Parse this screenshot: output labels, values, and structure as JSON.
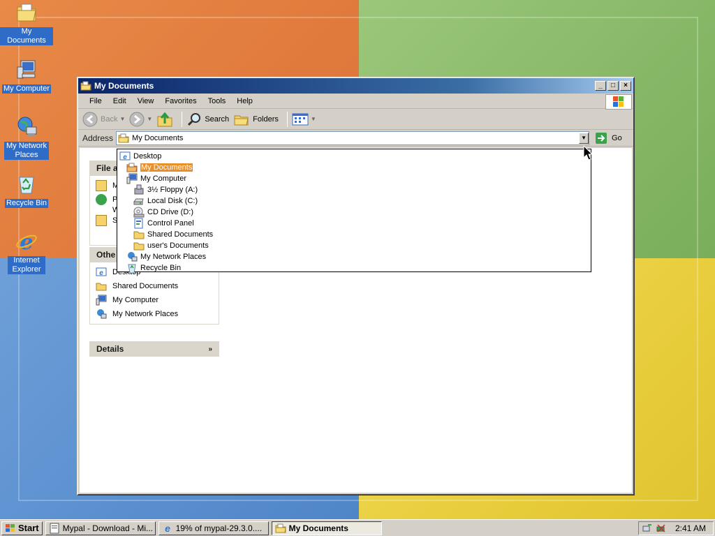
{
  "desktop": {
    "icons": [
      {
        "label": "My Documents",
        "icon": "my-documents-icon"
      },
      {
        "label": "My Computer",
        "icon": "my-computer-icon"
      },
      {
        "label": "My Network Places",
        "icon": "network-places-icon"
      },
      {
        "label": "Recycle Bin",
        "icon": "recycle-bin-icon"
      },
      {
        "label": "Internet Explorer",
        "icon": "internet-explorer-icon"
      }
    ]
  },
  "window": {
    "title": "My Documents",
    "menu": [
      "File",
      "Edit",
      "View",
      "Favorites",
      "Tools",
      "Help"
    ],
    "toolbar": {
      "back": "Back",
      "search": "Search",
      "folders": "Folders"
    },
    "address": {
      "label": "Address",
      "value": "My Documents",
      "go": "Go"
    },
    "panels": {
      "file_tasks": {
        "title": "File a",
        "items": [
          "M",
          "P",
          "W",
          "S"
        ]
      },
      "other_places": {
        "title": "Othe",
        "items": [
          "Desktop",
          "Shared Documents",
          "My Computer",
          "My Network Places"
        ]
      },
      "details": {
        "title": "Details"
      }
    },
    "dropdown": [
      {
        "label": "Desktop",
        "indent": 0,
        "icon": "desktop-icon"
      },
      {
        "label": "My Documents",
        "indent": 1,
        "icon": "folder-icon",
        "selected": true
      },
      {
        "label": "My Computer",
        "indent": 1,
        "icon": "my-computer-icon"
      },
      {
        "label": "3½ Floppy (A:)",
        "indent": 2,
        "icon": "floppy-icon"
      },
      {
        "label": "Local Disk (C:)",
        "indent": 2,
        "icon": "hard-disk-icon"
      },
      {
        "label": "CD Drive (D:)",
        "indent": 2,
        "icon": "cd-drive-icon"
      },
      {
        "label": "Control Panel",
        "indent": 2,
        "icon": "control-panel-icon"
      },
      {
        "label": "Shared Documents",
        "indent": 2,
        "icon": "folder-icon"
      },
      {
        "label": "user's Documents",
        "indent": 2,
        "icon": "folder-icon"
      },
      {
        "label": "My Network Places",
        "indent": 1,
        "icon": "network-places-icon"
      },
      {
        "label": "Recycle Bin",
        "indent": 1,
        "icon": "recycle-bin-icon"
      }
    ]
  },
  "taskbar": {
    "start": "Start",
    "tasks": [
      "Mypal - Download - Mi...",
      "19% of mypal-29.3.0....",
      "My Documents"
    ],
    "clock": "2:41 AM"
  },
  "colors": {
    "selection": "#e8902c",
    "titlebar": "#0a246a",
    "desktop_label_bg": "#2f6cc7"
  }
}
